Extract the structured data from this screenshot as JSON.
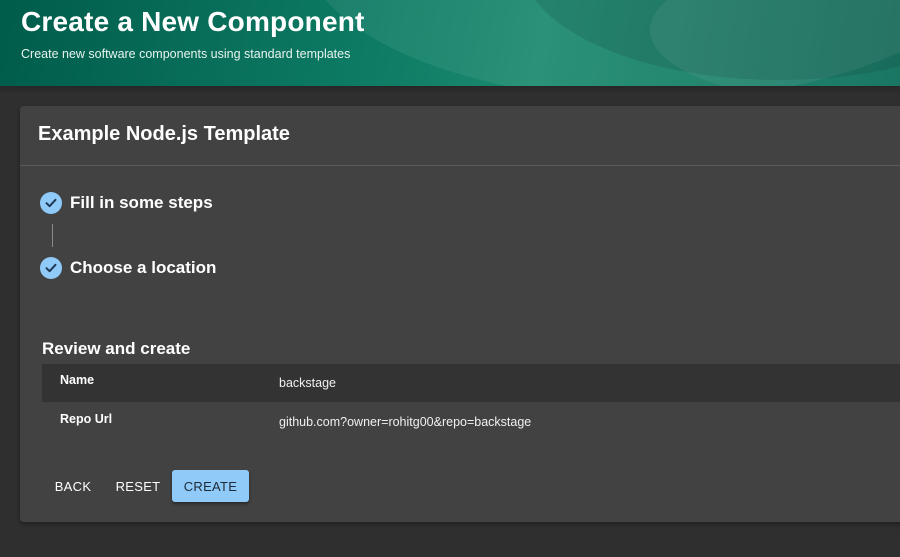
{
  "header": {
    "title": "Create a New Component",
    "subtitle": "Create new software components using standard templates"
  },
  "card": {
    "title": "Example Node.js Template",
    "steps": [
      {
        "label": "Fill in some steps",
        "status": "completed",
        "icon": "check-circle-icon"
      },
      {
        "label": "Choose a location",
        "status": "completed",
        "icon": "check-circle-icon"
      }
    ],
    "review": {
      "title": "Review and create",
      "rows": [
        {
          "key": "Name",
          "value": "backstage"
        },
        {
          "key": "Repo Url",
          "value": "github.com?owner=rohitg00&repo=backstage"
        }
      ]
    },
    "buttons": {
      "back": "BACK",
      "reset": "RESET",
      "create": "CREATE"
    }
  },
  "colors": {
    "header_bg": "#0d7a63",
    "page_bg": "#2f2f2f",
    "card_bg": "#424242",
    "accent": "#90caf9"
  }
}
